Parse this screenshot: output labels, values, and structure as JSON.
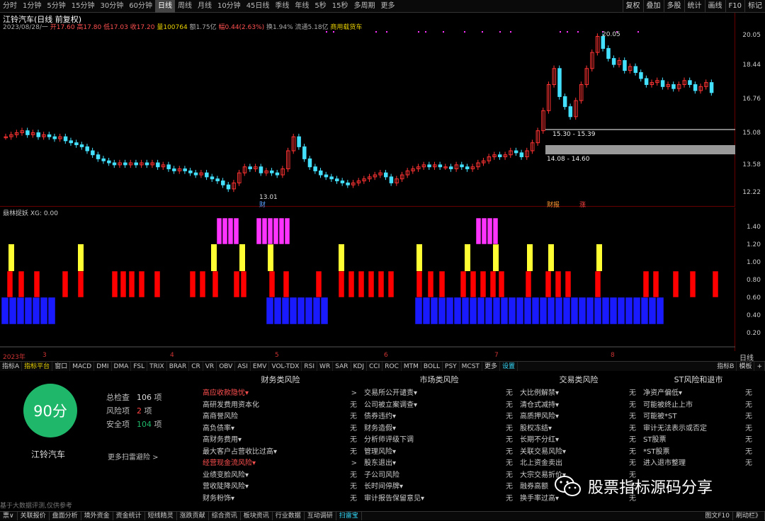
{
  "toolbar": {
    "left": [
      "分时",
      "1分钟",
      "5分钟",
      "15分钟",
      "30分钟",
      "60分钟",
      "日线",
      "周线",
      "月线",
      "10分钟",
      "45日线",
      "季线",
      "年线",
      "5秒",
      "15秒",
      "多周期",
      "更多"
    ],
    "active": "日线",
    "right": [
      "复权",
      "叠加",
      "多股",
      "统计",
      "画线",
      "F10",
      "标记"
    ]
  },
  "header": {
    "title": "江铃汽车(日线 前复权)",
    "info_date": "2023/08/28/一",
    "open": "开17.60",
    "high": "高17.80",
    "low": "低17.03",
    "close": "收17.20",
    "vol": "量100764",
    "amount": "额1.75亿",
    "change": "幅0.44(2.63%)",
    "turnover": "换1.94%",
    "float_cap": "流通5.18亿",
    "sector": "商用载货车"
  },
  "main_axis": [
    "20.05",
    "18.44",
    "16.76",
    "15.08",
    "13.58",
    "12.22"
  ],
  "annotations": {
    "high_label": "20.05",
    "low_label": "13.01",
    "zone1": "15.30 - 15.39",
    "zone2": "14.08 - 14.60",
    "marker_cai": "财",
    "marker_cai2": "财报",
    "marker_zhang": "涨"
  },
  "sub": {
    "title": "赑林捉妖 XG: 0.00",
    "axis": [
      "1.40",
      "1.20",
      "1.00",
      "0.80",
      "0.60",
      "0.40",
      "0.20"
    ]
  },
  "date_axis": [
    "2023年",
    "3",
    "4",
    "5",
    "6",
    "7",
    "8"
  ],
  "date_axis_right": "日线",
  "tabs": [
    "指标A",
    "指标平台",
    "窗口",
    "MACD",
    "DMI",
    "DMA",
    "FSL",
    "TRIX",
    "BRAR",
    "CR",
    "VR",
    "OBV",
    "ASI",
    "EMV",
    "VOL-TDX",
    "RSI",
    "WR",
    "SAR",
    "KDJ",
    "CCI",
    "ROC",
    "MTM",
    "BOLL",
    "PSY",
    "MCST",
    "更多",
    "设置"
  ],
  "tabs_right": [
    "指标B",
    "模板",
    "+"
  ],
  "summary": {
    "score": "90分",
    "stock": "江铃汽车",
    "total_label": "总检查",
    "total": "106",
    "total_unit": "项",
    "risk_label": "风险项",
    "risk": "2",
    "risk_unit": "项",
    "safe_label": "安全项",
    "safe": "104",
    "safe_unit": "项",
    "more": "更多扫雷避险 >",
    "disclaimer": "基于大数据评测,仅供参考"
  },
  "columns": [
    {
      "title": "财务类风险",
      "items": [
        [
          "高应收款隐忧▾",
          ">"
        ],
        [
          "高研发费用资本化",
          "无"
        ],
        [
          "高商誉风险",
          "无"
        ],
        [
          "高负债率▾",
          "无"
        ],
        [
          "高财务费用▾",
          "无"
        ],
        [
          "最大客户占营收比过高▾",
          "无"
        ],
        [
          "经营现金流风险▾",
          ">"
        ],
        [
          "业绩变脸风险▾",
          "无"
        ],
        [
          "营收陡降风险▾",
          "无"
        ],
        [
          "财务粉饰▾",
          "无"
        ]
      ]
    },
    {
      "title": "市场类风险",
      "items": [
        [
          "交易所公开谴责▾",
          "无"
        ],
        [
          "公司被立案调查▾",
          "无"
        ],
        [
          "债券违约▾",
          "无"
        ],
        [
          "财务造假▾",
          "无"
        ],
        [
          "分析师评级下调",
          "无"
        ],
        [
          "管理风险▾",
          "无"
        ],
        [
          "股东退出▾",
          "无"
        ],
        [
          "子公司风险",
          "无"
        ],
        [
          "长时间停牌▾",
          "无"
        ],
        [
          "审计报告保留意见▾",
          "无"
        ]
      ]
    },
    {
      "title": "交易类风险",
      "items": [
        [
          "大比例解禁▾",
          "无"
        ],
        [
          "清仓式减持▾",
          "无"
        ],
        [
          "高质押风险▾",
          "无"
        ],
        [
          "股权冻结▾",
          "无"
        ],
        [
          "长期不分红▾",
          "无"
        ],
        [
          "关联交易风险▾",
          "无"
        ],
        [
          "北上资金卖出",
          "无"
        ],
        [
          "大宗交易折价▾",
          "无"
        ],
        [
          "融券高额",
          "无"
        ],
        [
          "换手率过高▾",
          "无"
        ]
      ]
    },
    {
      "title": "ST风险和退市",
      "items": [
        [
          "净资产偏低▾",
          "无"
        ],
        [
          "可能被终止上市",
          "无"
        ],
        [
          "可能被*ST",
          "无"
        ],
        [
          "审计无法表示或否定",
          "无"
        ],
        [
          "ST股票",
          "无"
        ],
        [
          "*ST股票",
          "无"
        ],
        [
          "进入退市整理",
          "无"
        ]
      ]
    }
  ],
  "statusbar": [
    "票∨",
    "关联报价",
    "盘面分析",
    "境外资金",
    "资金统计",
    "短线精灵",
    "涨跌贡献",
    "综合资讯",
    "板块资讯",
    "行业数据",
    "互动调研",
    "扫雷宝"
  ],
  "statusbar_right": [
    "图文F10",
    "刷动栏》"
  ],
  "watermark": "股票指标源码分享",
  "colors": {
    "up": "#ff3333",
    "down": "#44e0ff",
    "magenta": "#ff33ff",
    "yellow": "#ffff33",
    "red": "#ff0000",
    "blue": "#1a1aff",
    "score": "#1fb86a"
  }
}
